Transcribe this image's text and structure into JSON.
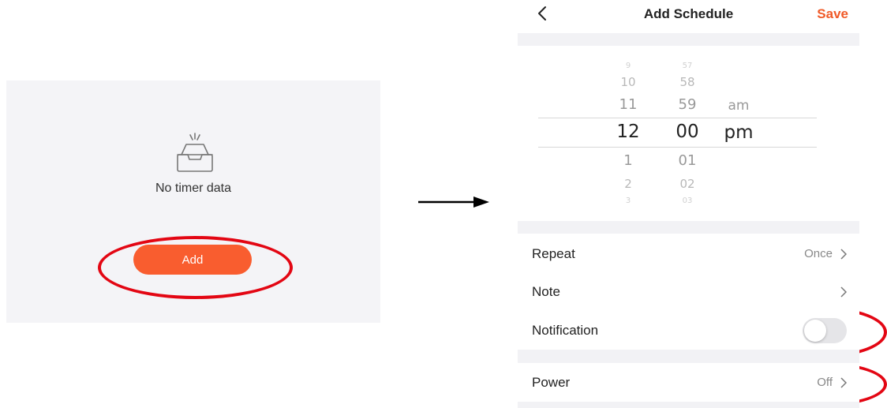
{
  "empty_state": {
    "icon": "empty-inbox-icon",
    "message": "No timer data",
    "add_label": "Add",
    "accent_color": "#f95d2f"
  },
  "header": {
    "back_icon": "chevron-left-icon",
    "title": "Add Schedule",
    "save_label": "Save",
    "accent_color": "#f05a28"
  },
  "time_picker": {
    "hours": [
      "9",
      "10",
      "11",
      "12",
      "1",
      "2",
      "3"
    ],
    "minutes": [
      "57",
      "58",
      "59",
      "00",
      "01",
      "02",
      "03"
    ],
    "periods": [
      "am",
      "pm"
    ],
    "selected": {
      "hour": "12",
      "minute": "00",
      "period": "pm"
    }
  },
  "settings": {
    "repeat": {
      "label": "Repeat",
      "value": "Once"
    },
    "note": {
      "label": "Note",
      "value": ""
    },
    "notification": {
      "label": "Notification",
      "enabled": false
    },
    "power": {
      "label": "Power",
      "value": "Off"
    }
  },
  "annotation_color": "#e30613"
}
